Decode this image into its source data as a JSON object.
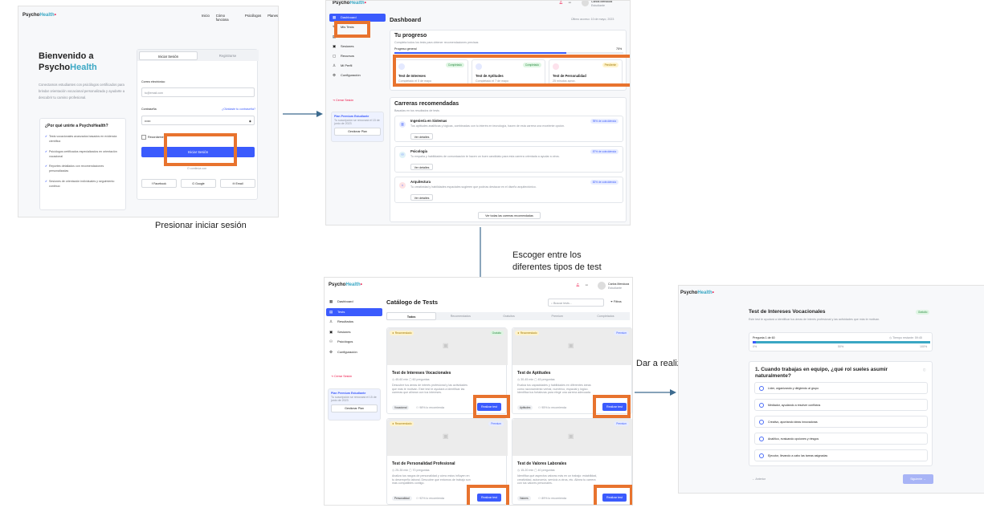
{
  "brand": {
    "part1": "Psycho",
    "part2": "Health",
    "dot": "•"
  },
  "captions": {
    "step1": "Presionar iniciar sesión",
    "step2_line1": "Escoger entre los",
    "step2_line2": "diferentes tipos de test",
    "step3": "Dar a realizar el test"
  },
  "login": {
    "nav": [
      "Inicio",
      "Cómo funciona",
      "Psicólogos",
      "Planes"
    ],
    "hero_line1": "Bienvenido a",
    "hero_line2a": "Psycho",
    "hero_line2b": "Health",
    "hero_desc": "Conectamos estudiantes con psicólogos certificados para brindar orientación vocacional personalizada y ayudarte a descubrir tu camino profesional.",
    "why_title": "¿Por qué unirte a PsychoHealth?",
    "why_items": [
      "Tests vocacionales avanzados basados en evidencia científica",
      "Psicólogos certificados especializados en orientación vocacional",
      "Reportes detallados con recomendaciones personalizadas",
      "Sesiones de orientación individuales y seguimiento continuo"
    ],
    "tab_login": "Iniciar Sesión",
    "tab_register": "Registrarse",
    "email_label": "Correo electrónico",
    "email_placeholder": "tu@email.com",
    "password_label": "Contraseña",
    "forgot": "¿Olvidaste tu contraseña?",
    "password_value": "••••••",
    "remember": "Recordarme",
    "submit": "Iniciar Sesión",
    "or": "O continúa con",
    "social": [
      "Facebook",
      "Google",
      "Email"
    ]
  },
  "sidebar": {
    "items": [
      "Dashboard",
      "Mis Tests",
      "Carreras",
      "Sesiones",
      "Recursos",
      "Mi Perfil",
      "Configuración"
    ],
    "items_catalog": [
      "Dashboard",
      "Tests",
      "Resultados",
      "Sesiones",
      "Psicólogos",
      "Configuración"
    ],
    "logout": "Cerrar Sesión",
    "premium_title": "Plan Premium Estudiante",
    "premium_desc": "Tu suscripción se renovará el 15 de junio de 2023",
    "premium_button": "Gestionar Plan"
  },
  "user": {
    "name": "Carlos Mendoza",
    "role": "Estudiante"
  },
  "dashboard": {
    "title": "Dashboard",
    "last_access": "Último acceso: 10 de mayo, 2023",
    "progress_title": "Tu progreso",
    "progress_desc": "Completa todos los tests para obtener recomendaciones precisas",
    "progress_label": "Progreso general",
    "progress_value": "75%",
    "progress_fraction": 0.75,
    "tests": [
      {
        "name": "Test de Intereses",
        "status": "Completado",
        "meta": "Completado el 5 de mayo"
      },
      {
        "name": "Test de Aptitudes",
        "status": "Completado",
        "meta": "Completado el 7 de mayo"
      },
      {
        "name": "Test de Personalidad",
        "status": "Pendiente",
        "meta": "25 minutos aprox."
      }
    ],
    "careers_title": "Carreras recomendadas",
    "careers_desc": "Basadas en tus resultados de tests",
    "careers": [
      {
        "name": "Ingeniería en Sistemas",
        "match": "95% de coincidencia",
        "desc": "Tus aptitudes analíticas y lógicas, combinadas con tu interés en tecnología, hacen de esta carrera una excelente opción."
      },
      {
        "name": "Psicología",
        "match": "87% de coincidencia",
        "desc": "Tu empatía y habilidades de comunicación te hacen un buen candidato para esta carrera orientada a ayudar a otros."
      },
      {
        "name": "Arquitectura",
        "match": "82% de coincidencia",
        "desc": "Tu creatividad y habilidades espaciales sugieren que podrías destacar en el diseño arquitectónico."
      }
    ],
    "details_button": "Ver detalles",
    "all_careers_button": "Ver todas las carreras recomendadas"
  },
  "catalog": {
    "title": "Catálogo de Tests",
    "search_placeholder": "Buscar tests...",
    "filters": "Filtros",
    "tabs": [
      "Todos",
      "Recomendados",
      "Gratuitos",
      "Premium",
      "Completados"
    ],
    "recommended_tag": "★ Recomendado",
    "start_button": "Realizar test",
    "tests": [
      {
        "name": "Test de Intereses Vocacionales",
        "badge": "Gratuito",
        "duration": "45-60 min",
        "questions": "60 preguntas",
        "desc": "Descubre tus áreas de interés profesional y las actividades que más te motivan. Este test te ayudará a identificar las carreras que alinean con tus intereses.",
        "category": "Vocacional",
        "rec": "98% lo recomienda",
        "recommended": true
      },
      {
        "name": "Test de Aptitudes",
        "badge": "Premium",
        "duration": "30-45 min",
        "questions": "45 preguntas",
        "desc": "Evalúa tus capacidades y habilidades en diferentes áreas como razonamiento verbal, numérico, espacial y lógico. Identifica tus fortalezas para elegir una carrera adecuada.",
        "category": "Aptitudes",
        "rec": "95% lo recomienda",
        "recommended": true
      },
      {
        "name": "Test de Personalidad Profesional",
        "badge": "Premium",
        "duration": "25-35 min",
        "questions": "70 preguntas",
        "desc": "Analiza tus rasgos de personalidad y cómo estos influyen en tu desempeño laboral. Descubre qué entornos de trabajo son más compatibles contigo.",
        "category": "Personalidad",
        "rec": "92% lo recomienda",
        "recommended": true
      },
      {
        "name": "Test de Valores Laborales",
        "badge": "Premium",
        "duration": "15-20 min",
        "questions": "40 preguntas",
        "desc": "Identifica qué aspectos valoras más en un trabajo: estabilidad, creatividad, autonomía, servicio a otros, etc. Alinea tu carrera con tus valores personales.",
        "category": "Valores",
        "rec": "89% lo recomienda",
        "recommended": false
      }
    ]
  },
  "test": {
    "title": "Test de Intereses Vocacionales",
    "badge": "Gratuito",
    "desc": "Este test te ayudará a identificar tus áreas de interés profesional y las actividades que más te motivan.",
    "question_counter": "Pregunta 1 de 60",
    "time_left": "Tiempo restante: 59:45",
    "progress_fraction": 0.02,
    "scale": [
      "0%",
      "50%",
      "100%"
    ],
    "question": "1. Cuando trabajas en equipo, ¿qué rol sueles asumir naturalmente?",
    "options": [
      "Líder, organizando y dirigiendo al grupo",
      "Mediador, ayudando a resolver conflictos",
      "Creativo, aportando ideas innovadoras",
      "Analítico, evaluando opciones y riesgos",
      "Ejecutor, llevando a cabo las tareas asignadas"
    ],
    "prev": "← Anterior",
    "next": "Siguiente →"
  },
  "colors": {
    "accent": "#3b5bfd",
    "highlight": "#e8732e",
    "teal": "#3aa7c4"
  }
}
